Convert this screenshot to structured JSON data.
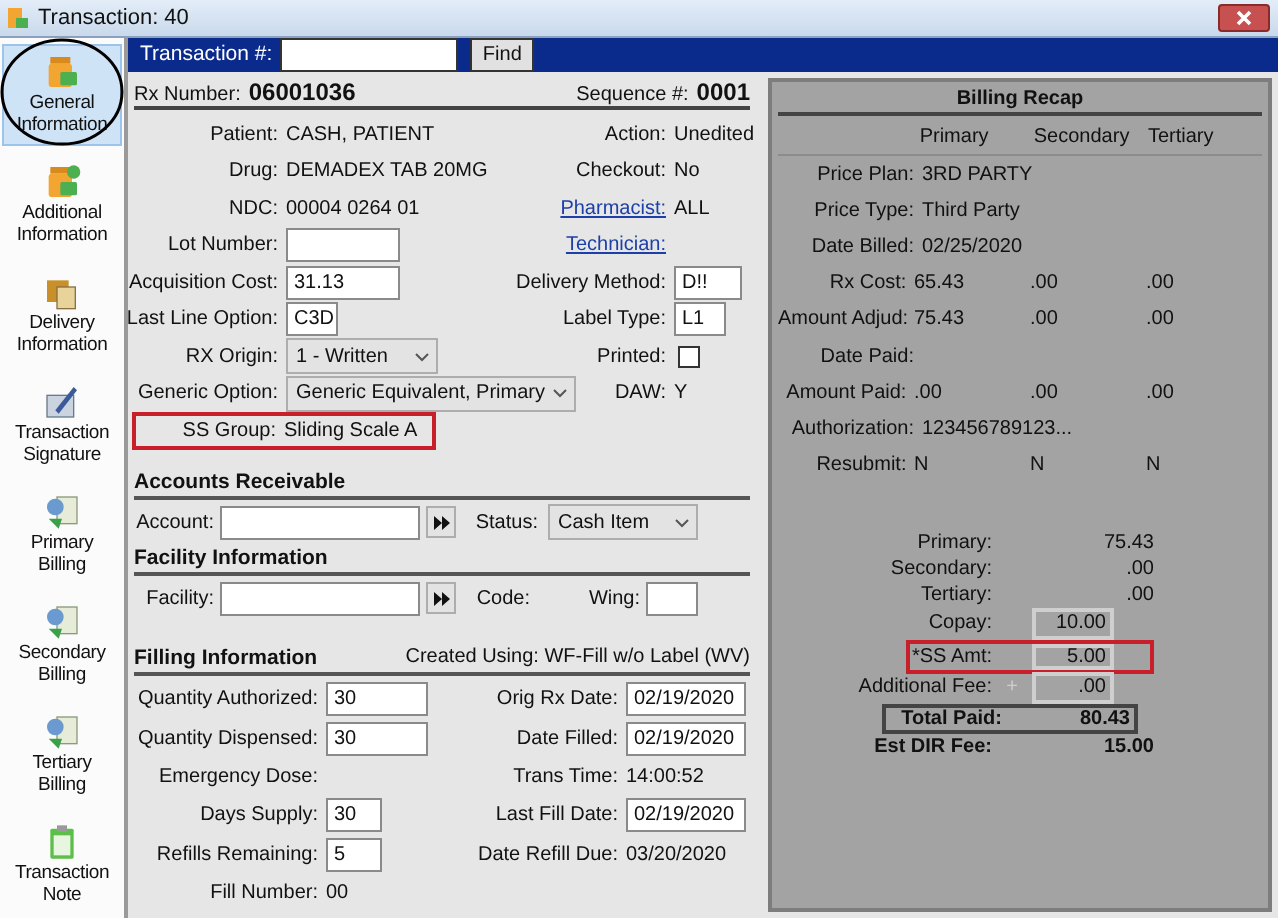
{
  "window": {
    "title": "Transaction: 40"
  },
  "sidebar": {
    "items": [
      {
        "label": "General Information",
        "selected": true,
        "circled": true
      },
      {
        "label": "Additional Information",
        "selected": false,
        "circled": false
      },
      {
        "label": "Delivery Information",
        "selected": false,
        "circled": false
      },
      {
        "label": "Transaction Signature",
        "selected": false,
        "circled": false
      },
      {
        "label": "Primary Billing",
        "selected": false,
        "circled": false
      },
      {
        "label": "Secondary Billing",
        "selected": false,
        "circled": false
      },
      {
        "label": "Tertiary Billing",
        "selected": false,
        "circled": false
      },
      {
        "label": "Transaction Note",
        "selected": false,
        "circled": false
      }
    ]
  },
  "search": {
    "label": "Transaction #:",
    "button": "Find"
  },
  "rx": {
    "label": "Rx Number:",
    "value": "06001036",
    "sequence_label": "Sequence #:",
    "sequence_value": "0001"
  },
  "details": [
    {
      "left": {
        "label": "Patient:",
        "kind": "text",
        "value": "CASH, PATIENT"
      },
      "right": {
        "label": "Action:",
        "kind": "text",
        "value": "Unedited"
      }
    },
    {
      "left": {
        "label": "Drug:",
        "kind": "text",
        "value": "DEMADEX TAB 20MG"
      },
      "right": {
        "label": "Checkout:",
        "kind": "text",
        "value": "No"
      }
    },
    {
      "left": {
        "label": "NDC:",
        "kind": "text",
        "value": "00004 0264 01"
      },
      "right": {
        "label": "Pharmacist:",
        "kind": "link",
        "value": "ALL"
      }
    },
    {
      "left": {
        "label": "Lot Number:",
        "kind": "input"
      },
      "right": {
        "label": "Technician:",
        "kind": "link"
      }
    },
    {
      "left": {
        "label": "Acquisition Cost:",
        "kind": "input",
        "value": "31.13"
      },
      "right": {
        "label": "Delivery Method:",
        "kind": "input",
        "value": "D!!"
      }
    },
    {
      "left": {
        "label": "Last Line Option:",
        "kind": "input",
        "value": "C3D"
      },
      "right": {
        "label": "Label Type:",
        "kind": "input",
        "value": "L1"
      }
    },
    {
      "left": {
        "label": "RX Origin:",
        "kind": "select",
        "value": "1 - Written"
      },
      "right": {
        "label": "Printed:",
        "kind": "checkbox",
        "checked": false
      }
    },
    {
      "left": {
        "label": "Generic Option:",
        "kind": "select",
        "value": "Generic Equivalent, Primary"
      },
      "right": {
        "label": "DAW:",
        "kind": "text",
        "value": "Y"
      }
    },
    {
      "left": {
        "label": "SS Group:",
        "kind": "text",
        "value": "Sliding Scale A",
        "highlighted": true
      }
    }
  ],
  "accounts": {
    "title": "Accounts Receivable",
    "account_label": "Account:",
    "status_label": "Status:",
    "status_value": "Cash Item"
  },
  "facility": {
    "title": "Facility Information",
    "facility_label": "Facility:",
    "code_label": "Code:",
    "wing_label": "Wing:"
  },
  "filling": {
    "title": "Filling Information",
    "created_using": "Created Using: WF-Fill w/o Label (WV)",
    "rows": [
      {
        "left": {
          "label": "Quantity Authorized:",
          "kind": "input",
          "value": "30"
        },
        "right": {
          "label": "Orig Rx Date:",
          "kind": "input",
          "value": "02/19/2020"
        }
      },
      {
        "left": {
          "label": "Quantity Dispensed:",
          "kind": "input",
          "value": "30"
        },
        "right": {
          "label": "Date Filled:",
          "kind": "input",
          "value": "02/19/2020"
        }
      },
      {
        "left": {
          "label": "Emergency Dose:",
          "kind": "text"
        },
        "right": {
          "label": "Trans Time:",
          "kind": "text",
          "value": "14:00:52"
        }
      },
      {
        "left": {
          "label": "Days Supply:",
          "kind": "input",
          "value": "30"
        },
        "right": {
          "label": "Last Fill Date:",
          "kind": "input",
          "value": "02/19/2020"
        }
      },
      {
        "left": {
          "label": "Refills Remaining:",
          "kind": "input",
          "value": "5"
        },
        "right": {
          "label": "Date Refill Due:",
          "kind": "text",
          "value": "03/20/2020"
        }
      },
      {
        "left": {
          "label": "Fill Number:",
          "kind": "text",
          "value": "00"
        }
      }
    ]
  },
  "recap": {
    "title": "Billing Recap",
    "columns": [
      "Primary",
      "Secondary",
      "Tertiary"
    ],
    "rows": [
      {
        "label": "Price Plan:",
        "values": [
          "3RD PARTY"
        ]
      },
      {
        "label": "Price Type:",
        "values": [
          "Third Party"
        ]
      },
      {
        "label": "Date Billed:",
        "values": [
          "02/25/2020"
        ]
      },
      {
        "label": "Rx Cost:",
        "values": [
          "65.43",
          ".00",
          ".00"
        ]
      },
      {
        "label": "Amount Adjud:",
        "values": [
          "75.43",
          ".00",
          ".00"
        ]
      },
      {
        "label": "Date Paid:",
        "values": []
      },
      {
        "label": "Amount Paid:",
        "values": [
          ".00",
          ".00",
          ".00"
        ]
      },
      {
        "label": "Authorization:",
        "values": [
          "123456789123..."
        ]
      },
      {
        "label": "Resubmit:",
        "values": [
          "N",
          "N",
          "N"
        ]
      }
    ],
    "totals": [
      {
        "label": "Primary:",
        "kind": "plain",
        "value": "75.43"
      },
      {
        "label": "Secondary:",
        "kind": "plain",
        "value": ".00"
      },
      {
        "label": "Tertiary:",
        "kind": "plain",
        "value": ".00"
      },
      {
        "label": "Copay:",
        "kind": "box",
        "value": "10.00"
      },
      {
        "label": "*SS Amt:",
        "kind": "box",
        "value": "5.00",
        "highlighted": true
      },
      {
        "label": "Additional Fee:",
        "kind": "box",
        "prefix": "+",
        "value": ".00"
      },
      {
        "label": "Total Paid:",
        "kind": "total",
        "value": "80.43"
      },
      {
        "label": "Est DIR Fee:",
        "kind": "bold",
        "value": "15.00"
      }
    ]
  }
}
